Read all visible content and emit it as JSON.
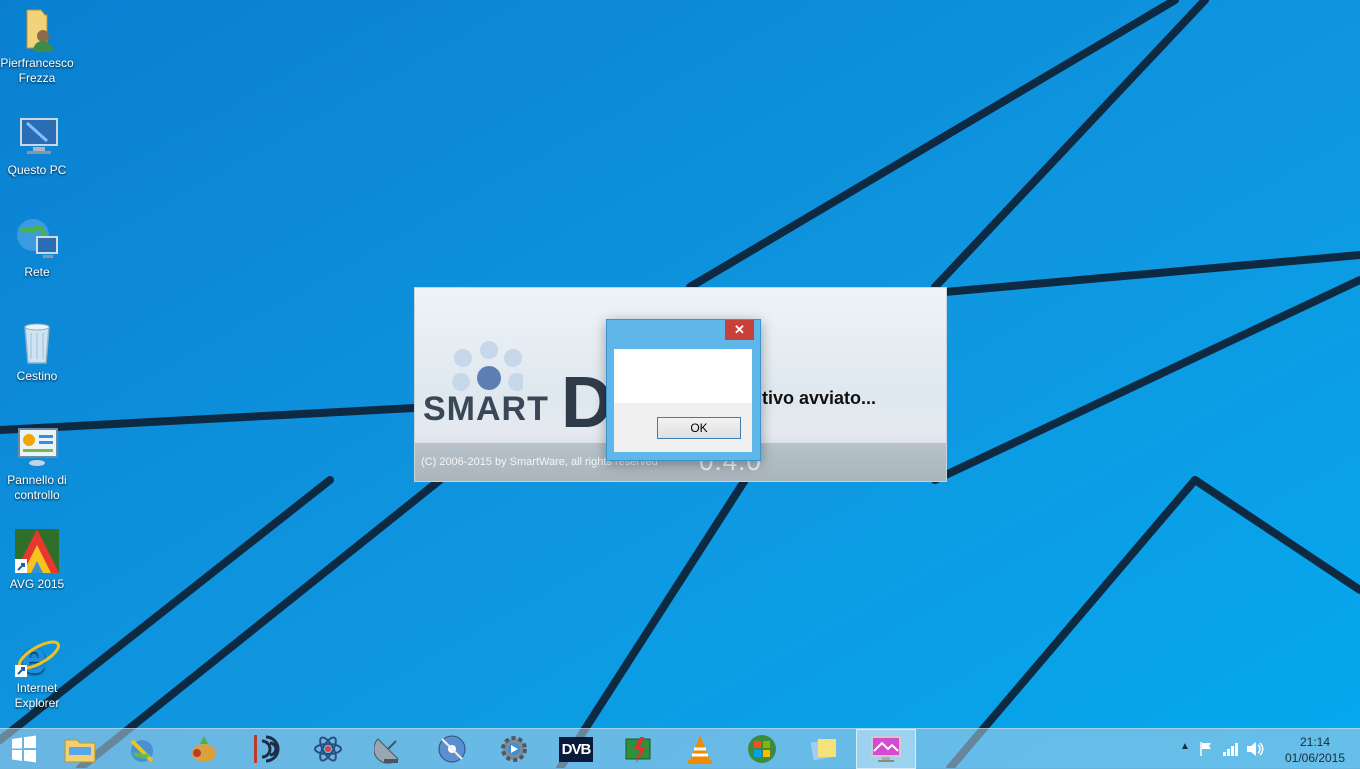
{
  "desktop": {
    "icons": [
      {
        "label": "Pierfrancesco Frezza",
        "icon": "user-folder-icon"
      },
      {
        "label": "Questo PC",
        "icon": "computer-icon"
      },
      {
        "label": "Rete",
        "icon": "network-icon"
      },
      {
        "label": "Cestino",
        "icon": "recycle-bin-icon"
      },
      {
        "label": "Pannello di controllo",
        "icon": "control-panel-icon"
      },
      {
        "label": "AVG 2015",
        "icon": "avg-icon"
      },
      {
        "label": "Internet Explorer",
        "icon": "internet-explorer-icon"
      }
    ]
  },
  "splash": {
    "logo_text": "SMART",
    "logo_letter": "D",
    "status": "sitivo avviato...",
    "copyright": "(C) 2006-2015 by SmartWare, all rights reserved",
    "version": "0.4.0"
  },
  "dialog": {
    "close_label": "✕",
    "ok_label": "OK"
  },
  "taskbar": {
    "apps": [
      "start",
      "file-explorer",
      "app-satellite",
      "app-fruit",
      "app-audio",
      "app-atom",
      "app-dish",
      "app-disc",
      "app-settings",
      "app-dvb",
      "app-battery",
      "vlc",
      "windows-7-logo",
      "app-notes",
      "smartd"
    ],
    "dvb_label": "DVB",
    "clock": {
      "time": "21:14",
      "date": "01/06/2015"
    }
  }
}
